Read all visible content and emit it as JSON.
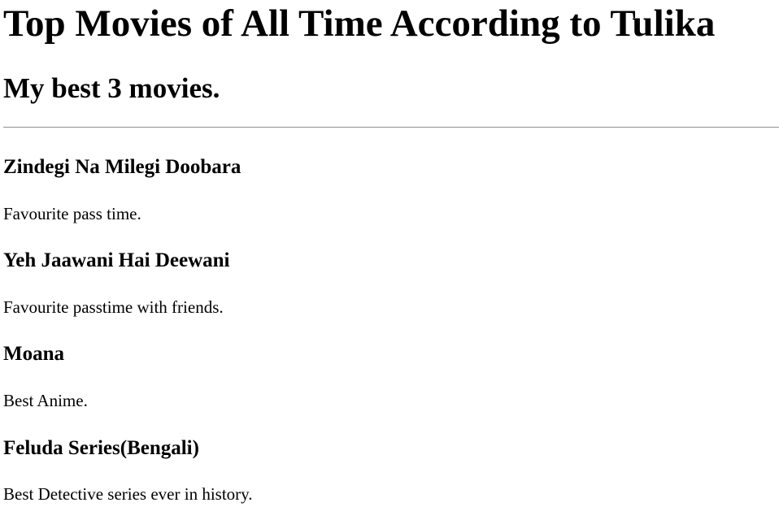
{
  "title": "Top Movies of All Time According to Tulika",
  "subtitle": "My best 3 movies.",
  "movies": [
    {
      "name": "Zindegi Na Milegi Doobara",
      "description": "Favourite pass time."
    },
    {
      "name": "Yeh Jaawani Hai Deewani",
      "description": "Favourite passtime with friends."
    },
    {
      "name": "Moana",
      "description": "Best Anime."
    },
    {
      "name": "Feluda Series(Bengali)",
      "description": "Best Detective series ever in history."
    }
  ]
}
